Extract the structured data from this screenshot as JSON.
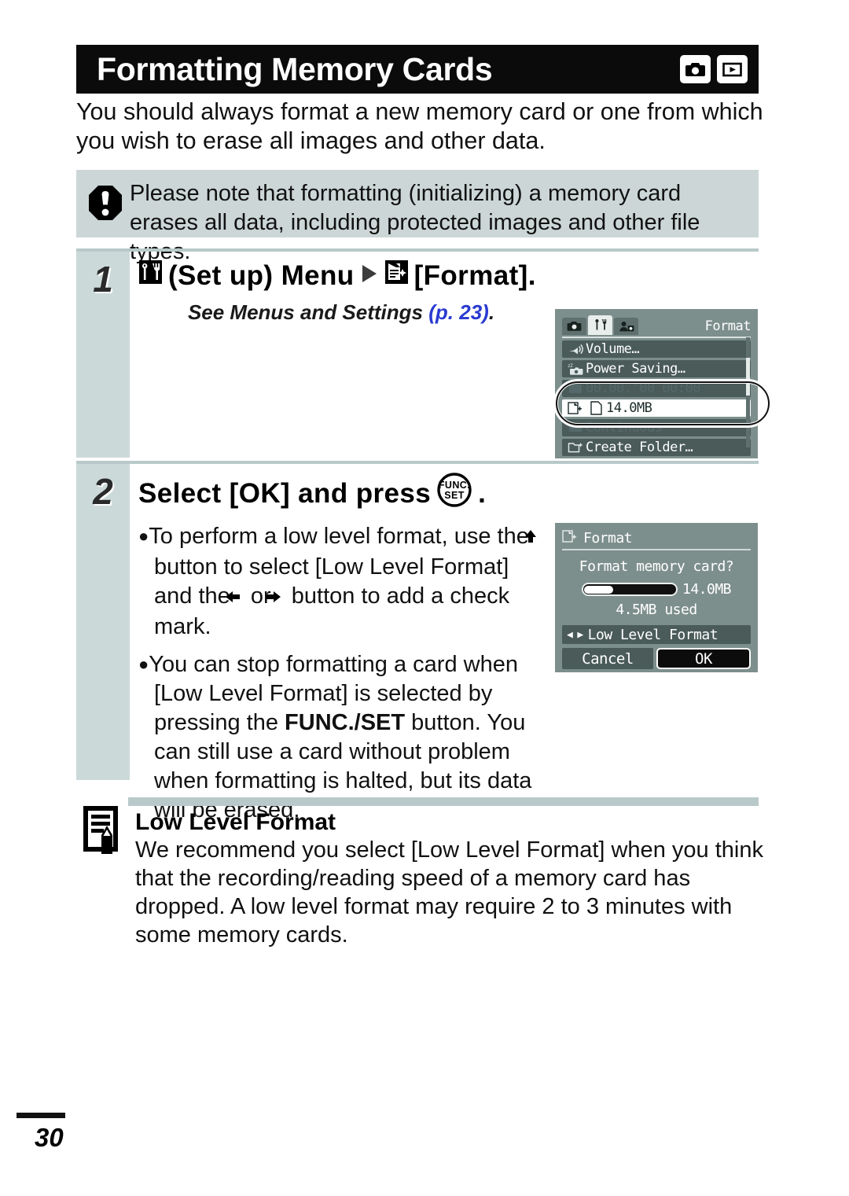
{
  "header": {
    "title": "Formatting Memory Cards",
    "icons": [
      "camera-shooting-icon",
      "playback-icon"
    ]
  },
  "intro": "You should always format a new memory card or one from which you wish to erase all images and other data.",
  "caution": {
    "icon": "exclamation-octagon-icon",
    "text": "Please note that formatting (initializing) a memory card erases all data, including protected images and other file types."
  },
  "steps": [
    {
      "number": "1",
      "heading_prefix": "(Set up) Menu",
      "heading_suffix": "[Format].",
      "setup_icon": "wrench-setup-icon",
      "arrow_icon": "right-triangle-icon",
      "format_icon": "format-card-icon",
      "see_text": "See Menus and Settings",
      "see_ref": "(p. 23)",
      "see_period": "."
    },
    {
      "number": "2",
      "heading_a": "Select [OK] and press",
      "heading_button": "FUNC./SET",
      "heading_b": ".",
      "bullets": [
        {
          "parts": [
            {
              "t": "To perform a low level format, use the "
            },
            {
              "icon": "up-arrow-icon"
            },
            {
              "t": " button to select [Low Level Format] and the "
            },
            {
              "icon": "left-arrow-icon"
            },
            {
              "t": " or "
            },
            {
              "icon": "right-arrow-icon"
            },
            {
              "t": " button to add a check mark."
            }
          ]
        },
        {
          "parts": [
            {
              "t": "You can stop formatting a card when [Low Level Format] is selected by pressing the "
            },
            {
              "t": "FUNC./SET",
              "bold": true
            },
            {
              "t": " button. You can still use a card without problem when formatting is halted, but its data will be erased."
            }
          ]
        }
      ]
    }
  ],
  "note": {
    "icon": "memo-pencil-icon",
    "title": "Low Level Format",
    "text": "We recommend you select [Low Level Format] when you think that the recording/reading speed of a memory card has dropped. A low level format may require 2 to 3 minutes with some memory cards."
  },
  "lcd_menu": {
    "title": "Format",
    "tabs": [
      {
        "name": "tab-rec",
        "icon": "camera-icon",
        "active": false
      },
      {
        "name": "tab-setup",
        "icon": "wrench-icon",
        "active": true
      },
      {
        "name": "tab-my-camera",
        "icon": "my-camera-icon",
        "active": false
      }
    ],
    "rows": [
      {
        "icon": "volume-icon",
        "label": "Volume…",
        "state": "normal"
      },
      {
        "icon": "power-saving-icon",
        "label": "Power Saving…",
        "state": "normal"
      },
      {
        "icon": "date-time-icon",
        "label": "00.00.'00 00:00",
        "state": "faded"
      },
      {
        "icon": "format-card-icon",
        "label": "14.0MB",
        "state": "selected"
      },
      {
        "icon": "file-no-icon",
        "label": "Continuous",
        "state": "faded"
      },
      {
        "icon": "create-folder-icon",
        "label": "Create Folder…",
        "state": "normal"
      }
    ]
  },
  "lcd_dialog": {
    "icon": "format-card-icon",
    "title": "Format",
    "question": "Format memory card?",
    "capacity": "14.0MB",
    "used": "4.5MB used",
    "bar_fill_percent": 32,
    "low_level_label": "Low Level Format",
    "cancel_label": "Cancel",
    "ok_label": "OK"
  },
  "footer": {
    "page_number": "30"
  }
}
